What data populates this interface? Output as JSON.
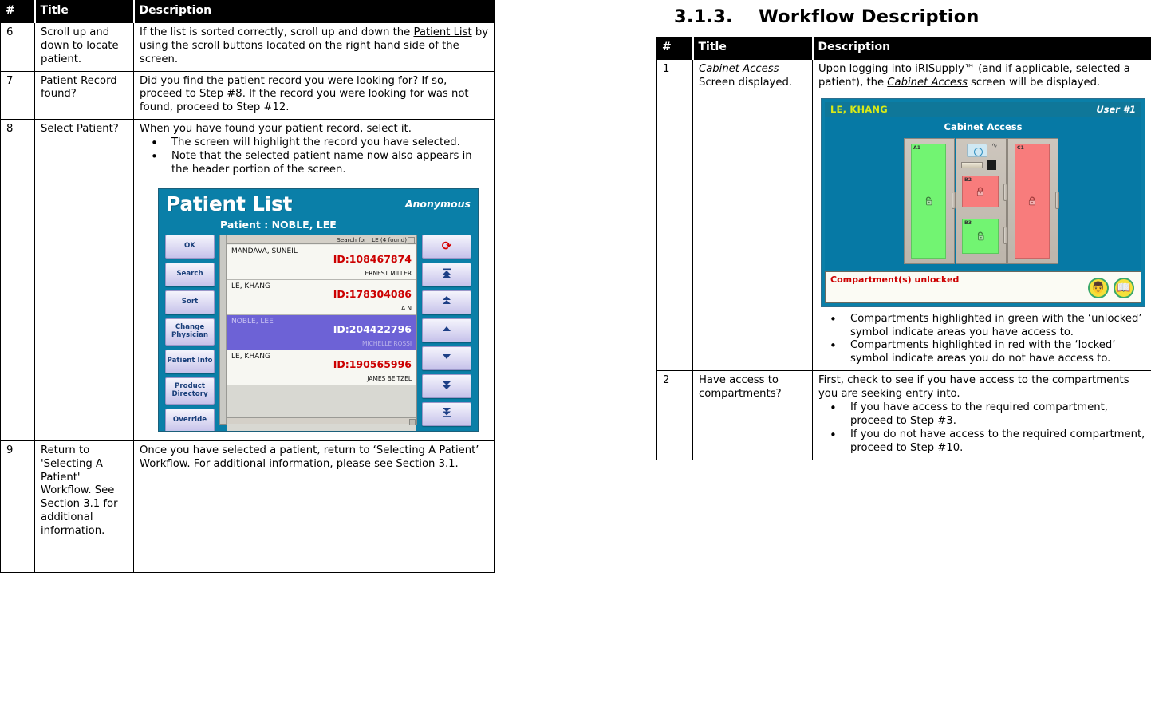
{
  "left_table": {
    "headers": [
      "#",
      "Title",
      "Description"
    ],
    "rows": [
      {
        "num": "6",
        "title": "Scroll up and down to locate patient.",
        "desc_pre": "If the list is sorted correctly, scroll up and down the ",
        "desc_link": "Patient List",
        "desc_post": " by using the scroll buttons located on the right hand side of the screen."
      },
      {
        "num": "7",
        "title": "Patient Record found?",
        "desc": "Did you find the patient record you were looking for?  If so, proceed to Step #8.  If the record you were looking for was not found, proceed to Step #12."
      },
      {
        "num": "8",
        "title": "Select Patient?",
        "desc_intro": "When you have found your patient record, select it.",
        "bullets": [
          "The screen will highlight the record you have selected.",
          "Note that the selected patient name now also appears in the header portion of the screen."
        ]
      },
      {
        "num": "9",
        "title": "Return to 'Selecting A Patient' Workflow.  See Section 3.1 for additional information.",
        "desc": "Once you have selected a patient, return to ‘Selecting A Patient’ Workflow.  For additional information, please see Section 3.1."
      }
    ]
  },
  "patient_list_screen": {
    "title": "Patient List",
    "user_label": "Anonymous",
    "patient_label": "Patient : NOBLE, LEE",
    "search_status": "Search for : LE (4 found)",
    "buttons": [
      "OK",
      "Search",
      "Sort",
      "Change Physician",
      "Patient Info",
      "Product Directory",
      "Override"
    ],
    "scroll_buttons": [
      {
        "name": "refresh-icon",
        "glyph": "◔",
        "color": "#d40000"
      },
      {
        "name": "scroll-top-icon",
        "glyph": "⤒",
        "color": "#1d3f86"
      },
      {
        "name": "scroll-page-up-icon",
        "glyph": "⇑",
        "color": "#1d3f86"
      },
      {
        "name": "scroll-up-icon",
        "glyph": "▲",
        "color": "#1d3f86"
      },
      {
        "name": "scroll-down-icon",
        "glyph": "▼",
        "color": "#1d3f86"
      },
      {
        "name": "scroll-page-down-icon",
        "glyph": "⇓",
        "color": "#1d3f86"
      },
      {
        "name": "scroll-bottom-icon",
        "glyph": "⤓",
        "color": "#1d3f86"
      }
    ],
    "rows": [
      {
        "name": "MANDAVA, SUNEIL",
        "id": "ID:108467874",
        "physician": "ERNEST MILLER",
        "selected": false
      },
      {
        "name": "LE, KHANG",
        "id": "ID:178304086",
        "physician": "A N",
        "selected": false
      },
      {
        "name": "NOBLE, LEE",
        "id": "ID:204422796",
        "physician": "MICHELLE ROSSI",
        "selected": true
      },
      {
        "name": "LE, KHANG",
        "id": "ID:190565996",
        "physician": "JAMES BEITZEL",
        "selected": false
      }
    ]
  },
  "right_section": {
    "heading_number": "3.1.3.",
    "heading_text": "Workflow Description",
    "heading_full": "3.1.3.    Workflow Description"
  },
  "right_table": {
    "headers": [
      "#",
      "Title",
      "Description"
    ],
    "rows": [
      {
        "num": "1",
        "title_link": "Cabinet Access",
        "title_rest": " Screen displayed.",
        "desc_pre": "Upon logging into iRISupply™ (and if applicable, selected a patient), the ",
        "desc_link": "Cabinet Access",
        "desc_post": " screen will be displayed.",
        "bullets": [
          "Compartments highlighted in green with the ‘unlocked’ symbol indicate areas you have access to.",
          "Compartments highlighted in red with the ‘locked’ symbol indicate areas you do not have access to."
        ]
      },
      {
        "num": "2",
        "title": "Have access to compartments?",
        "desc_intro": "First, check to see if you have access to the compartments you are seeking entry into.",
        "bullets": [
          "If you have access to the required compartment, proceed to Step #3.",
          "If you do not have access to the required compartment, proceed to Step #10."
        ]
      }
    ]
  },
  "cabinet_access_screen": {
    "user_name": "LE, KHANG",
    "user_number": "User #1",
    "title": "Cabinet Access",
    "status_text": "Compartment(s) unlocked",
    "compartments": [
      {
        "label": "A1",
        "state": "unlocked",
        "color": "#72f472"
      },
      {
        "label": "B2",
        "state": "locked",
        "color": "#f87c7c"
      },
      {
        "label": "B3",
        "state": "unlocked",
        "color": "#72f472"
      },
      {
        "label": "C1",
        "state": "locked",
        "color": "#f87c7c"
      }
    ],
    "footer_icons": [
      "nurse-icon",
      "book-icon"
    ]
  },
  "colors": {
    "screen_teal": "#0679a5",
    "header_black": "#000000",
    "id_red": "#cc0000",
    "selected_row": "#6d62d6",
    "green_compartment": "#72f472",
    "red_compartment": "#f87c7c",
    "user_yellow": "#d9ea18"
  }
}
